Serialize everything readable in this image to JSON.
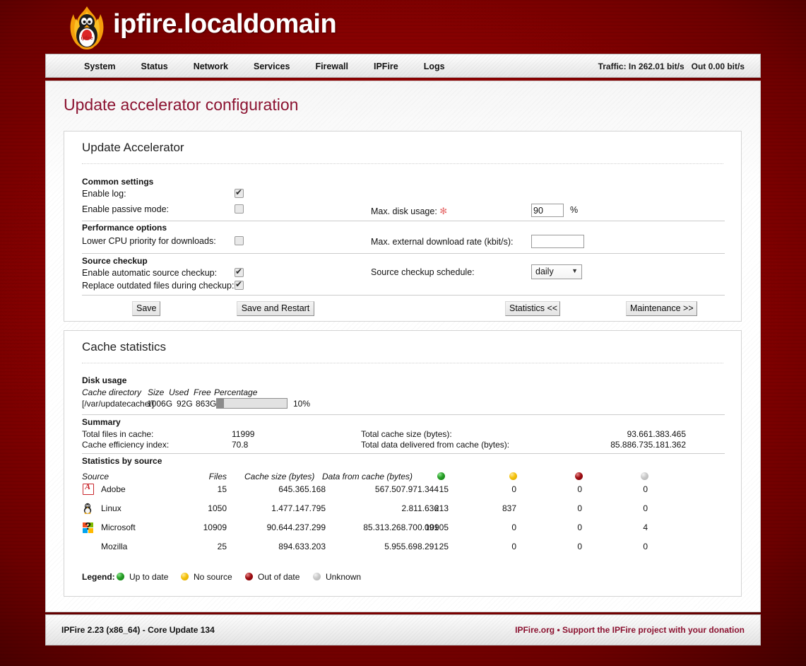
{
  "header": {
    "site_title": "ipfire.localdomain",
    "logo_icon": "ipfire-penguin-flame-logo"
  },
  "menu": {
    "items": [
      {
        "label": "System"
      },
      {
        "label": "Status"
      },
      {
        "label": "Network"
      },
      {
        "label": "Services"
      },
      {
        "label": "Firewall"
      },
      {
        "label": "IPFire"
      },
      {
        "label": "Logs"
      }
    ],
    "traffic": "Traffic: In 262.01 bit/s   Out 0.00 bit/s"
  },
  "page": {
    "title": "Update accelerator configuration"
  },
  "config": {
    "legend": "Update Accelerator",
    "common_settings_label": "Common settings",
    "enable_log_label": "Enable log:",
    "enable_log_checked": true,
    "enable_passive_label": "Enable passive mode:",
    "enable_passive_checked": false,
    "max_disk_usage_label": "Max. disk usage:",
    "max_disk_usage_required": "✻",
    "max_disk_usage_value": "90",
    "max_disk_usage_unit": "%",
    "performance_label": "Performance options",
    "lower_cpu_label": "Lower CPU priority for downloads:",
    "lower_cpu_checked": false,
    "max_rate_label": "Max. external download rate (kbit/s):",
    "max_rate_value": "",
    "source_checkup_label": "Source checkup",
    "auto_checkup_label": "Enable automatic source checkup:",
    "auto_checkup_checked": true,
    "replace_outdated_label": "Replace outdated files during checkup:",
    "replace_outdated_checked": true,
    "schedule_label": "Source checkup schedule:",
    "schedule_value": "daily",
    "buttons": {
      "save": "Save",
      "save_restart": "Save and Restart",
      "statistics": "Statistics <<",
      "maintenance": "Maintenance >>"
    }
  },
  "stats": {
    "legend": "Cache statistics",
    "disk_usage": {
      "title": "Disk usage",
      "headers": [
        "Cache directory",
        "Size",
        "Used",
        "Free",
        "Percentage"
      ],
      "directory": "[/var/updatecache/]",
      "size": "1006G",
      "used": "92G",
      "free": "863G",
      "percent_label": "10%",
      "percent_value": 10
    },
    "summary": {
      "title": "Summary",
      "rows": [
        {
          "label": "Total files in cache:",
          "value": "11999",
          "label2": "Total cache size (bytes):",
          "value2": "93.661.383.465"
        },
        {
          "label": "Cache efficiency index:",
          "value": "70.8",
          "label2": "Total data delivered from cache (bytes):",
          "value2": "85.886.735.181.362"
        }
      ]
    },
    "by_source": {
      "title": "Statistics by source",
      "headers": [
        "Source",
        "Files",
        "Cache size (bytes)",
        "Data from cache (bytes)"
      ],
      "status_headers": [
        "green-led",
        "yellow-led",
        "red-led",
        "gray-led"
      ],
      "rows": [
        {
          "icon": "adobe-icon",
          "name": "Adobe",
          "files": "15",
          "cache_size": "645.365.168",
          "data_from_cache": "567.507.971.344",
          "up_to_date": "15",
          "no_source": "0",
          "out_of_date": "0",
          "unknown": "0"
        },
        {
          "icon": "linux-penguin-icon",
          "name": "Linux",
          "files": "1050",
          "cache_size": "1.477.147.795",
          "data_from_cache": "2.811.636",
          "up_to_date": "213",
          "no_source": "837",
          "out_of_date": "0",
          "unknown": "0"
        },
        {
          "icon": "microsoft-icon",
          "name": "Microsoft",
          "files": "10909",
          "cache_size": "90.644.237.299",
          "data_from_cache": "85.313.268.700.091",
          "up_to_date": "10905",
          "no_source": "0",
          "out_of_date": "0",
          "unknown": "4"
        },
        {
          "icon": "question-mark-icon",
          "name": "Mozilla",
          "files": "25",
          "cache_size": "894.633.203",
          "data_from_cache": "5.955.698.291",
          "up_to_date": "25",
          "no_source": "0",
          "out_of_date": "0",
          "unknown": "0"
        }
      ]
    },
    "legend_row": {
      "title": "Legend:",
      "items": [
        {
          "color": "#2aa02a",
          "label": "Up to date"
        },
        {
          "color": "#f4c20a",
          "label": "No source"
        },
        {
          "color": "#9e0d12",
          "label": "Out of date"
        },
        {
          "color": "#c9c9c9",
          "label": "Unknown"
        }
      ]
    }
  },
  "footer": {
    "left": "IPFire 2.23 (x86_64) - Core Update 134",
    "right": "IPFire.org • Support the IPFire project with your donation"
  }
}
